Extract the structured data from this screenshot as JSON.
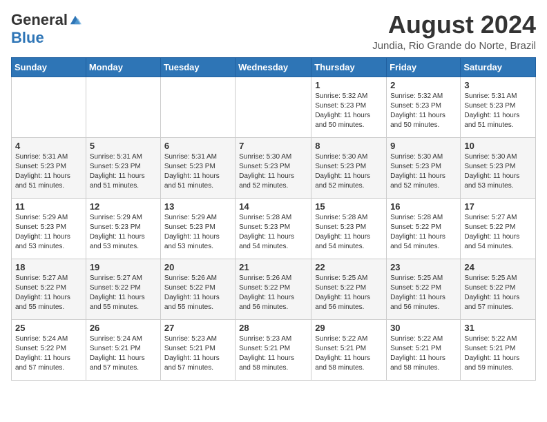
{
  "header": {
    "logo_general": "General",
    "logo_blue": "Blue",
    "month_year": "August 2024",
    "location": "Jundia, Rio Grande do Norte, Brazil"
  },
  "days_of_week": [
    "Sunday",
    "Monday",
    "Tuesday",
    "Wednesday",
    "Thursday",
    "Friday",
    "Saturday"
  ],
  "weeks": [
    [
      {
        "day": "",
        "info": ""
      },
      {
        "day": "",
        "info": ""
      },
      {
        "day": "",
        "info": ""
      },
      {
        "day": "",
        "info": ""
      },
      {
        "day": "1",
        "info": "Sunrise: 5:32 AM\nSunset: 5:23 PM\nDaylight: 11 hours\nand 50 minutes."
      },
      {
        "day": "2",
        "info": "Sunrise: 5:32 AM\nSunset: 5:23 PM\nDaylight: 11 hours\nand 50 minutes."
      },
      {
        "day": "3",
        "info": "Sunrise: 5:31 AM\nSunset: 5:23 PM\nDaylight: 11 hours\nand 51 minutes."
      }
    ],
    [
      {
        "day": "4",
        "info": "Sunrise: 5:31 AM\nSunset: 5:23 PM\nDaylight: 11 hours\nand 51 minutes."
      },
      {
        "day": "5",
        "info": "Sunrise: 5:31 AM\nSunset: 5:23 PM\nDaylight: 11 hours\nand 51 minutes."
      },
      {
        "day": "6",
        "info": "Sunrise: 5:31 AM\nSunset: 5:23 PM\nDaylight: 11 hours\nand 51 minutes."
      },
      {
        "day": "7",
        "info": "Sunrise: 5:30 AM\nSunset: 5:23 PM\nDaylight: 11 hours\nand 52 minutes."
      },
      {
        "day": "8",
        "info": "Sunrise: 5:30 AM\nSunset: 5:23 PM\nDaylight: 11 hours\nand 52 minutes."
      },
      {
        "day": "9",
        "info": "Sunrise: 5:30 AM\nSunset: 5:23 PM\nDaylight: 11 hours\nand 52 minutes."
      },
      {
        "day": "10",
        "info": "Sunrise: 5:30 AM\nSunset: 5:23 PM\nDaylight: 11 hours\nand 53 minutes."
      }
    ],
    [
      {
        "day": "11",
        "info": "Sunrise: 5:29 AM\nSunset: 5:23 PM\nDaylight: 11 hours\nand 53 minutes."
      },
      {
        "day": "12",
        "info": "Sunrise: 5:29 AM\nSunset: 5:23 PM\nDaylight: 11 hours\nand 53 minutes."
      },
      {
        "day": "13",
        "info": "Sunrise: 5:29 AM\nSunset: 5:23 PM\nDaylight: 11 hours\nand 53 minutes."
      },
      {
        "day": "14",
        "info": "Sunrise: 5:28 AM\nSunset: 5:23 PM\nDaylight: 11 hours\nand 54 minutes."
      },
      {
        "day": "15",
        "info": "Sunrise: 5:28 AM\nSunset: 5:23 PM\nDaylight: 11 hours\nand 54 minutes."
      },
      {
        "day": "16",
        "info": "Sunrise: 5:28 AM\nSunset: 5:22 PM\nDaylight: 11 hours\nand 54 minutes."
      },
      {
        "day": "17",
        "info": "Sunrise: 5:27 AM\nSunset: 5:22 PM\nDaylight: 11 hours\nand 54 minutes."
      }
    ],
    [
      {
        "day": "18",
        "info": "Sunrise: 5:27 AM\nSunset: 5:22 PM\nDaylight: 11 hours\nand 55 minutes."
      },
      {
        "day": "19",
        "info": "Sunrise: 5:27 AM\nSunset: 5:22 PM\nDaylight: 11 hours\nand 55 minutes."
      },
      {
        "day": "20",
        "info": "Sunrise: 5:26 AM\nSunset: 5:22 PM\nDaylight: 11 hours\nand 55 minutes."
      },
      {
        "day": "21",
        "info": "Sunrise: 5:26 AM\nSunset: 5:22 PM\nDaylight: 11 hours\nand 56 minutes."
      },
      {
        "day": "22",
        "info": "Sunrise: 5:25 AM\nSunset: 5:22 PM\nDaylight: 11 hours\nand 56 minutes."
      },
      {
        "day": "23",
        "info": "Sunrise: 5:25 AM\nSunset: 5:22 PM\nDaylight: 11 hours\nand 56 minutes."
      },
      {
        "day": "24",
        "info": "Sunrise: 5:25 AM\nSunset: 5:22 PM\nDaylight: 11 hours\nand 57 minutes."
      }
    ],
    [
      {
        "day": "25",
        "info": "Sunrise: 5:24 AM\nSunset: 5:22 PM\nDaylight: 11 hours\nand 57 minutes."
      },
      {
        "day": "26",
        "info": "Sunrise: 5:24 AM\nSunset: 5:21 PM\nDaylight: 11 hours\nand 57 minutes."
      },
      {
        "day": "27",
        "info": "Sunrise: 5:23 AM\nSunset: 5:21 PM\nDaylight: 11 hours\nand 57 minutes."
      },
      {
        "day": "28",
        "info": "Sunrise: 5:23 AM\nSunset: 5:21 PM\nDaylight: 11 hours\nand 58 minutes."
      },
      {
        "day": "29",
        "info": "Sunrise: 5:22 AM\nSunset: 5:21 PM\nDaylight: 11 hours\nand 58 minutes."
      },
      {
        "day": "30",
        "info": "Sunrise: 5:22 AM\nSunset: 5:21 PM\nDaylight: 11 hours\nand 58 minutes."
      },
      {
        "day": "31",
        "info": "Sunrise: 5:22 AM\nSunset: 5:21 PM\nDaylight: 11 hours\nand 59 minutes."
      }
    ]
  ]
}
